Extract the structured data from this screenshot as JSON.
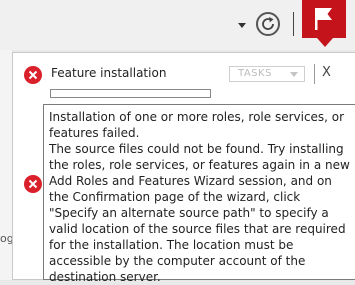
{
  "toolbar": {
    "dropdown_icon": "chevron-down-icon",
    "refresh_icon": "refresh-icon",
    "flag_icon": "notification-flag-icon",
    "flag_color": "#c4131b"
  },
  "background_fragment": "og",
  "notifications": [
    {
      "icon": "error-icon",
      "title": "Feature installation",
      "tasks_label": "TASKS",
      "close_label": "X",
      "progress": 0
    },
    {
      "icon": "error-icon"
    }
  ],
  "tooltip": {
    "line1": "Installation of one or more roles, role services, or features failed.",
    "line2": "The source files could not be found. Try installing the roles, role services, or features again in a new Add Roles and Features Wizard session, and on the Confirmation page of the wizard, click \"Specify an alternate source path\" to specify a valid location of the source files that are required for the installation. The location must be accessible by the computer account of the destination server."
  },
  "colors": {
    "error": "#d9202b",
    "accent": "#c4131b"
  }
}
